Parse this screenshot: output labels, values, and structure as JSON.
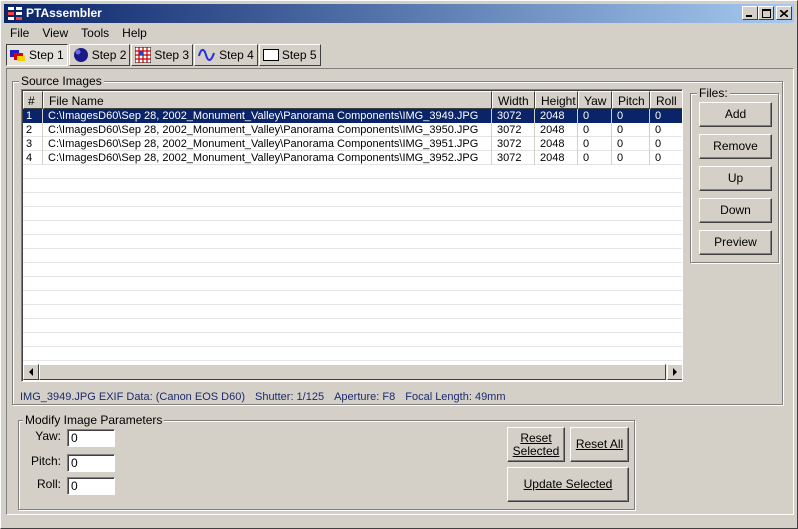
{
  "window": {
    "title": "PTAssembler"
  },
  "menu": [
    "File",
    "View",
    "Tools",
    "Help"
  ],
  "toolbar": {
    "steps": [
      {
        "label": "Step 1",
        "icon": "step1-icon"
      },
      {
        "label": "Step 2",
        "icon": "step2-icon"
      },
      {
        "label": "Step 3",
        "icon": "step3-icon"
      },
      {
        "label": "Step 4",
        "icon": "step4-icon"
      },
      {
        "label": "Step 5",
        "icon": "step5-icon"
      }
    ]
  },
  "source_images": {
    "legend": "Source Images",
    "columns": [
      "#",
      "File Name",
      "Width",
      "Height",
      "Yaw",
      "Pitch",
      "Roll"
    ],
    "rows": [
      {
        "num": "1",
        "file": "C:\\ImagesD60\\Sep 28, 2002_Monument_Valley\\Panorama Components\\IMG_3949.JPG",
        "width": "3072",
        "height": "2048",
        "yaw": "0",
        "pitch": "0",
        "roll": "0",
        "selected": true
      },
      {
        "num": "2",
        "file": "C:\\ImagesD60\\Sep 28, 2002_Monument_Valley\\Panorama Components\\IMG_3950.JPG",
        "width": "3072",
        "height": "2048",
        "yaw": "0",
        "pitch": "0",
        "roll": "0",
        "selected": false
      },
      {
        "num": "3",
        "file": "C:\\ImagesD60\\Sep 28, 2002_Monument_Valley\\Panorama Components\\IMG_3951.JPG",
        "width": "3072",
        "height": "2048",
        "yaw": "0",
        "pitch": "0",
        "roll": "0",
        "selected": false
      },
      {
        "num": "4",
        "file": "C:\\ImagesD60\\Sep 28, 2002_Monument_Valley\\Panorama Components\\IMG_3952.JPG",
        "width": "3072",
        "height": "2048",
        "yaw": "0",
        "pitch": "0",
        "roll": "0",
        "selected": false
      }
    ]
  },
  "files_panel": {
    "legend": "Files:",
    "add": "Add",
    "remove": "Remove",
    "up": "Up",
    "down": "Down",
    "preview": "Preview"
  },
  "exif": {
    "file_info": "IMG_3949.JPG EXIF Data: (Canon EOS D60)",
    "shutter": "Shutter: 1/125",
    "aperture": "Aperture: F8",
    "focal": "Focal Length: 49mm"
  },
  "params": {
    "legend": "Modify Image Parameters",
    "yaw_label": "Yaw:",
    "yaw_value": "0",
    "pitch_label": "Pitch:",
    "pitch_value": "0",
    "roll_label": "Roll:",
    "roll_value": "0",
    "reset_selected_line1": "Reset",
    "reset_selected_line2": "Selected",
    "reset_all": "Reset All",
    "update_selected": "Update Selected"
  },
  "colors": {
    "title_gradient_start": "#0a246a",
    "title_gradient_end": "#a6caf0",
    "selection": "#0a246a",
    "face": "#d4d0c8",
    "exif_text": "#1c2a6e"
  }
}
